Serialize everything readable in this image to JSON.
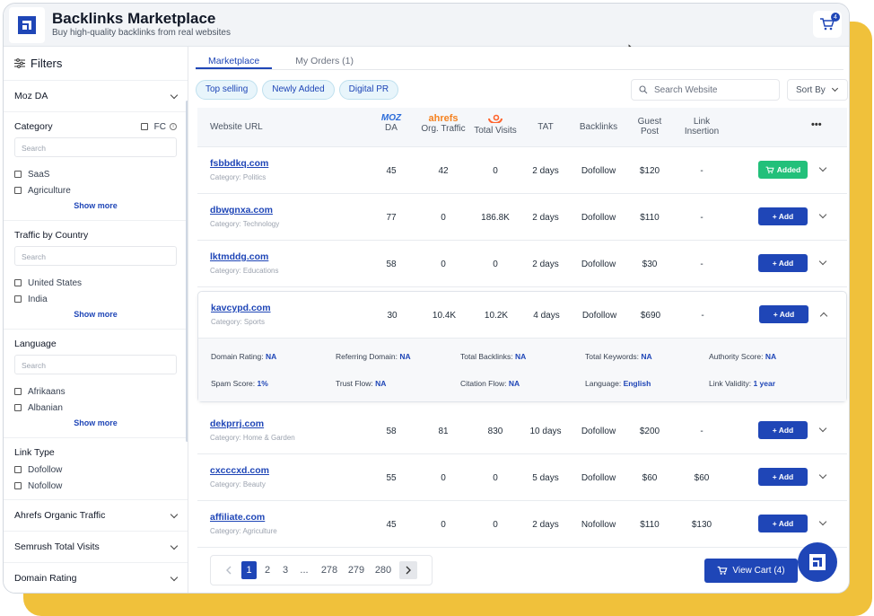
{
  "header": {
    "title": "Backlinks Marketplace",
    "subtitle": "Buy high-quality backlinks from real websites",
    "cart_count": "4"
  },
  "sidebar": {
    "heading": "Filters",
    "moz_da": "Moz DA",
    "category": {
      "title": "Category",
      "fc": "FC",
      "search": "Search",
      "options": [
        "SaaS",
        "Agriculture"
      ],
      "more": "Show more"
    },
    "traffic": {
      "title": "Traffic by Country",
      "search": "Search",
      "options": [
        "United States",
        "India"
      ],
      "more": "Show more"
    },
    "language": {
      "title": "Language",
      "search": "Search",
      "options": [
        "Afrikaans",
        "Albanian"
      ],
      "more": "Show more"
    },
    "link_type": {
      "title": "Link Type",
      "options": [
        "Dofollow",
        "Nofollow"
      ]
    },
    "ahrefs": "Ahrefs Organic Traffic",
    "semrush": "Semrush Total Visits",
    "domain_rating": "Domain Rating"
  },
  "tabs": [
    "Marketplace",
    "My Orders (1)"
  ],
  "chips": [
    "Top selling",
    "Newly Added",
    "Digital PR"
  ],
  "search_placeholder": "Search Website",
  "sort_label": "Sort By",
  "columns": {
    "url": "Website URL",
    "moz_logo": "MOZ",
    "da": "DA",
    "ahrefs_logo": "ahrefs",
    "traffic": "Org. Traffic",
    "visits": "Total Visits",
    "tat": "TAT",
    "backlinks": "Backlinks",
    "guest_1": "Guest",
    "guest_2": "Post",
    "link_1": "Link",
    "link_2": "Insertion",
    "more": "•••"
  },
  "rows": [
    {
      "site": "fsbbdkq.com",
      "category": "Category: Politics",
      "da": "45",
      "traffic": "42",
      "visits": "0",
      "tat": "2 days",
      "backlinks": "Dofollow",
      "guest": "$120",
      "insertion": "-",
      "action": "Added"
    },
    {
      "site": "dbwgnxa.com",
      "category": "Category: Technology",
      "da": "77",
      "traffic": "0",
      "visits": "186.8K",
      "tat": "2 days",
      "backlinks": "Dofollow",
      "guest": "$110",
      "insertion": "-",
      "action": "+ Add"
    },
    {
      "site": "lktmddg.com",
      "category": "Category: Educations",
      "da": "58",
      "traffic": "0",
      "visits": "0",
      "tat": "2 days",
      "backlinks": "Dofollow",
      "guest": "$30",
      "insertion": "-",
      "action": "+ Add"
    },
    {
      "site": "kavcypd.com",
      "category": "Category: Sports",
      "da": "30",
      "traffic": "10.4K",
      "visits": "10.2K",
      "tat": "4 days",
      "backlinks": "Dofollow",
      "guest": "$690",
      "insertion": "-",
      "action": "+ Add"
    },
    {
      "site": "dekprrj.com",
      "category": "Category: Home & Garden",
      "da": "58",
      "traffic": "81",
      "visits": "830",
      "tat": "10 days",
      "backlinks": "Dofollow",
      "guest": "$200",
      "insertion": "-",
      "action": "+ Add"
    },
    {
      "site": "cxcccxd.com",
      "category": "Category: Beauty",
      "da": "55",
      "traffic": "0",
      "visits": "0",
      "tat": "5 days",
      "backlinks": "Dofollow",
      "guest": "$60",
      "insertion": "$60",
      "action": "+ Add"
    },
    {
      "site": "affiliate.com",
      "category": "Category: Agriculture",
      "da": "45",
      "traffic": "0",
      "visits": "0",
      "tat": "2 days",
      "backlinks": "Nofollow",
      "guest": "$110",
      "insertion": "$130",
      "action": "+ Add"
    }
  ],
  "details": {
    "domain_rating": {
      "label": "Domain Rating:",
      "value": "NA"
    },
    "referring_domain": {
      "label": "Referring Domain:",
      "value": "NA"
    },
    "total_backlinks": {
      "label": "Total Backlinks:",
      "value": "NA"
    },
    "total_keywords": {
      "label": "Total Keywords:",
      "value": "NA"
    },
    "authority_score": {
      "label": "Authority Score:",
      "value": "NA"
    },
    "spam_score": {
      "label": "Spam Score:",
      "value": "1%"
    },
    "trust_flow": {
      "label": "Trust Flow:",
      "value": "NA"
    },
    "citation_flow": {
      "label": "Citation Flow:",
      "value": "NA"
    },
    "language": {
      "label": "Language:",
      "value": "English"
    },
    "link_validity": {
      "label": "Link Validity:",
      "value": "1 year"
    }
  },
  "pagination": {
    "pages": [
      "1",
      "2",
      "3",
      "...",
      "278",
      "279",
      "280"
    ]
  },
  "view_cart": "View Cart (4)",
  "colors": {
    "primary": "#1f46b7",
    "added": "#22c07a",
    "backdrop": "#f0c13b"
  }
}
